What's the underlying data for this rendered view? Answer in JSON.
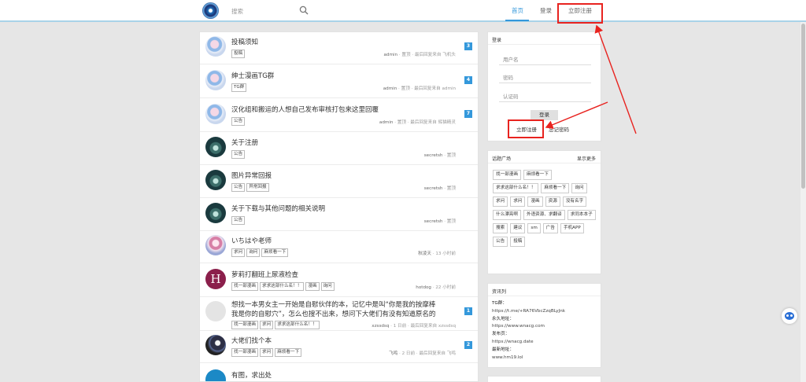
{
  "header": {
    "search_placeholder": "搜索",
    "nav": {
      "home": "首页",
      "login": "登录",
      "register": "立即注册"
    }
  },
  "topics": [
    {
      "title": "投稿须知",
      "tags": [
        "投稿"
      ],
      "author": "admin",
      "meta": " · 置顶 · 最后回复来自 飞机头",
      "count": "3",
      "avatar": "anime"
    },
    {
      "title": "绅士漫画TG群",
      "tags": [
        "TG群"
      ],
      "author": "admin",
      "meta": " · 置顶 · 最后回复来自 admin",
      "count": "4",
      "avatar": "anime"
    },
    {
      "title": "汉化组和搬运的人想自己发布审核打包来这里回覆",
      "tags": [
        "公告"
      ],
      "author": "admin",
      "meta": " · 置顶 · 最后回复来自 辉猫精灵",
      "count": "7",
      "avatar": "anime"
    },
    {
      "title": "关于注册",
      "tags": [
        "公告"
      ],
      "author": "secretsh",
      "meta": " · 置顶",
      "count": "",
      "avatar": "teal"
    },
    {
      "title": "图片异常回报",
      "tags": [
        "公告",
        "异常回报"
      ],
      "author": "secretsh",
      "meta": " · 置顶",
      "count": "",
      "avatar": "teal"
    },
    {
      "title": "关于下载与其他问题的相关说明",
      "tags": [
        "公告"
      ],
      "author": "secretsh",
      "meta": " · 置顶",
      "count": "",
      "avatar": "teal"
    },
    {
      "title": "いちはや老师",
      "tags": [
        "求问",
        "询问",
        "麻烦看一下"
      ],
      "author": "秋凌天",
      "meta": " · 13 小时前",
      "count": "",
      "avatar": "girl"
    },
    {
      "title": "萝莉打翻班上尿液检查",
      "tags": [
        "找一部漫画",
        "求求这部什么名！！",
        "漫画",
        "询问"
      ],
      "author": "hotdog",
      "meta": " · 22 小时前",
      "count": "",
      "avatar": "h"
    },
    {
      "title": "想找一本男女主一开始是自慰伙伴的本，记忆中是叫“你是我的按摩棒我是你的自慰穴”，怎么也搜不出来，想问下大佬们有没有知道原名的",
      "tags": [
        "找一部漫画",
        "求问",
        "求求这部什么名！！"
      ],
      "author": "xzssdsq",
      "meta": " · 1 日前 · 最后回复来自 xzssdsq",
      "count": "1",
      "avatar": "gray"
    },
    {
      "title": "大佬们找个本",
      "tags": [
        "找一部漫画",
        "求问",
        "麻烦看一下"
      ],
      "author": "飞鸣",
      "meta": " · 2 日前 · 最后回复来自 飞鸣",
      "count": "2",
      "avatar": "dark"
    },
    {
      "title": "有图，求出处",
      "tags": [],
      "author": "",
      "meta": "",
      "count": "",
      "avatar": "blue"
    }
  ],
  "login_panel": {
    "title": "登录",
    "username_placeholder": "用户名",
    "password_placeholder": "密码",
    "captcha_placeholder": "认证码",
    "login_button": "登录",
    "register_link": "立即注册",
    "forgot_link": "忘记密码"
  },
  "topic_panel": {
    "title": "话题广场",
    "more": "显示更多",
    "tags": [
      "找一部漫画",
      "麻烦看一下",
      "求求这部什么名！！",
      "麻烦看一下",
      "询问",
      "求问",
      "求问",
      "漫画",
      "资源",
      "没有名字",
      "什么漂亮啊",
      "外语资源、求翻译",
      "求同本本子",
      "搜索",
      "建议",
      "sm",
      "广告",
      "手机APP",
      "公告",
      "投稿"
    ]
  },
  "resource_panel": {
    "title": "资讯列",
    "lines": [
      {
        "label": "TG群：",
        "value": "https://t.me/+RA76VbcZzqBLyJnk"
      },
      {
        "label": "永久地址：",
        "value": "https://www.wnacg.com"
      },
      {
        "label": "发布页：",
        "value": "https://wnacg.date"
      },
      {
        "label": "最新地址：",
        "value": "www.hm19.lol"
      }
    ]
  }
}
